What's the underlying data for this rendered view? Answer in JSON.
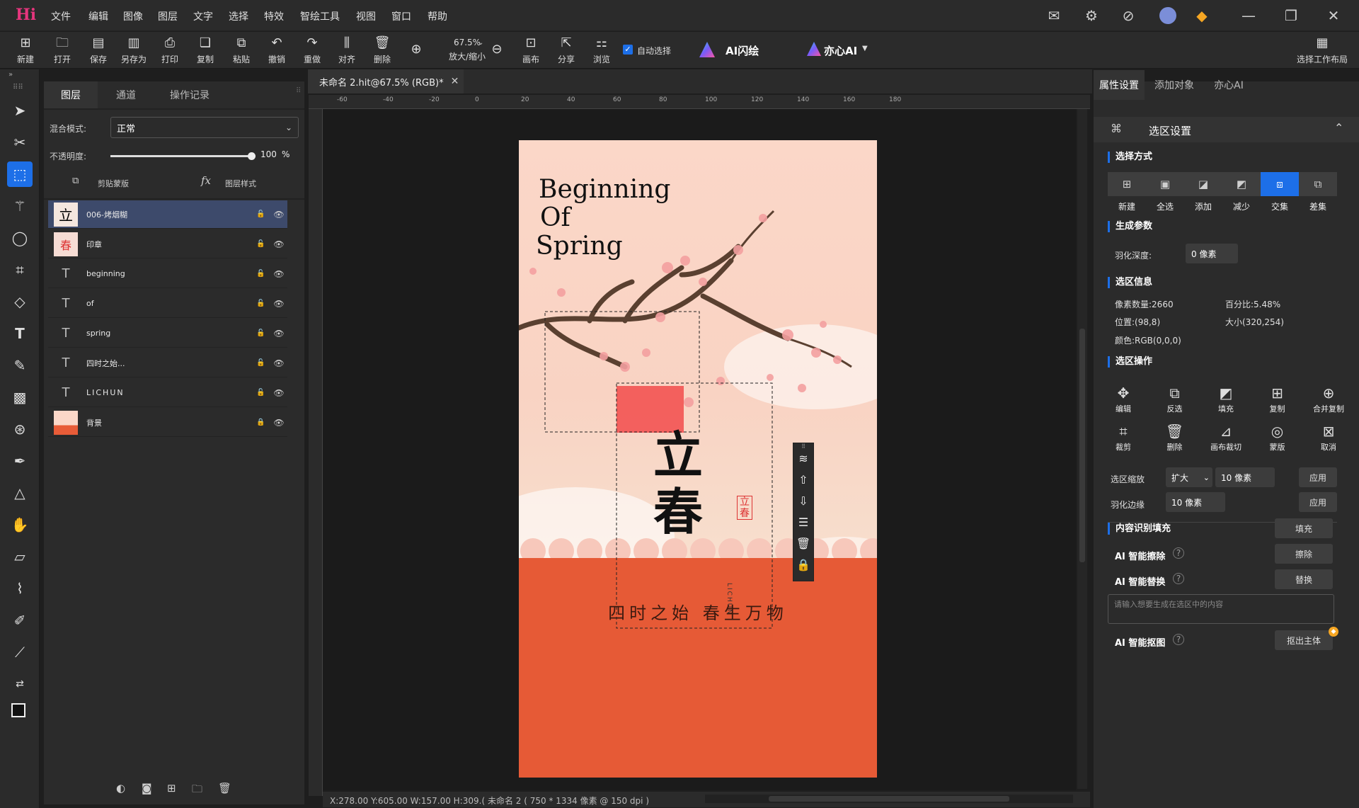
{
  "menu": [
    "文件",
    "编辑",
    "图像",
    "图层",
    "文字",
    "选择",
    "特效",
    "智绘工具",
    "视图",
    "窗口",
    "帮助"
  ],
  "toolbar": {
    "items": [
      "新建",
      "打开",
      "保存",
      "另存为",
      "打印",
      "复制",
      "粘贴",
      "撤销",
      "重做",
      "对齐",
      "删除"
    ],
    "zoom_value": "67.5%",
    "zoom_label": "放大/缩小",
    "items2": [
      "画布",
      "分享",
      "浏览"
    ],
    "auto_select": "自动选择",
    "ai_flash": "AI闪绘",
    "yixin_ai": "亦心AI",
    "workspace": "选择工作布局"
  },
  "layers_panel": {
    "tabs": [
      "图层",
      "通道",
      "操作记录"
    ],
    "blend_label": "混合模式:",
    "blend_value": "正常",
    "opacity_label": "不透明度:",
    "opacity_value": "100",
    "opacity_unit": "%",
    "opacity_fraction": 1.0,
    "clip_label": "剪贴蒙版",
    "style_label": "图层样式",
    "layers": [
      {
        "name": "006-烤烟糊",
        "type": "image",
        "selected": true
      },
      {
        "name": "印章",
        "type": "image",
        "selected": false
      },
      {
        "name": "beginning",
        "type": "text",
        "selected": false
      },
      {
        "name": "of",
        "type": "text",
        "selected": false
      },
      {
        "name": "spring",
        "type": "text",
        "selected": false
      },
      {
        "name": "四时之始...",
        "type": "text",
        "selected": false
      },
      {
        "name": "LICHUN",
        "type": "text",
        "selected": false
      },
      {
        "name": "背景",
        "type": "image",
        "selected": false
      }
    ]
  },
  "document": {
    "tab_title": "未命名 2.hit@67.5% (RGB)*",
    "ruler_labels": [
      "-60",
      "-40",
      "-20",
      "0",
      "20",
      "40",
      "60",
      "80",
      "100",
      "120",
      "140",
      "160",
      "180"
    ],
    "poster": {
      "title_lines": [
        "Beginning",
        "Of",
        "Spring"
      ],
      "calligraphy": "立春",
      "seal": "立春",
      "vertical_text": "LICHUN",
      "bottom_text": "四时之始 春生万物"
    },
    "status": "X:278.00 Y:605.00 W:157.00 H:309.(    未命名 2 ( 750 * 1334 像素 @ 150 dpi )"
  },
  "right_panel": {
    "tabs": [
      "属性设置",
      "添加对象",
      "亦心AI"
    ],
    "header": "选区设置",
    "select_mode_title": "选择方式",
    "select_modes": [
      "新建",
      "全选",
      "添加",
      "减少",
      "交集",
      "差集"
    ],
    "active_mode": "交集",
    "gen_params_title": "生成参数",
    "feather_depth_label": "羽化深度:",
    "feather_depth_value": "0 像素",
    "info_title": "选区信息",
    "info": {
      "pixels": "像素数量:2660",
      "percent": "百分比:5.48%",
      "position": "位置:(98,8)",
      "size": "大小(320,254)",
      "color": "颜色:RGB(0,0,0)"
    },
    "ops_title": "选区操作",
    "ops_row1": [
      "编辑",
      "反选",
      "填充",
      "复制",
      "合并复制"
    ],
    "ops_row2": [
      "裁剪",
      "删除",
      "画布裁切",
      "蒙版",
      "取消"
    ],
    "scale_label": "选区缩放",
    "scale_mode": "扩大",
    "scale_value": "10 像素",
    "apply": "应用",
    "feather_edge_label": "羽化边缘",
    "feather_edge_value": "10 像素",
    "content_fill_title": "内容识别填充",
    "fill_btn": "填充",
    "ai_erase_label": "AI 智能擦除",
    "erase_btn": "擦除",
    "ai_replace_label": "AI 智能替换",
    "replace_btn": "替换",
    "replace_placeholder": "请输入想要生成在选区中的内容",
    "ai_cutout_label": "AI 智能抠图",
    "cutout_btn": "抠出主体"
  }
}
